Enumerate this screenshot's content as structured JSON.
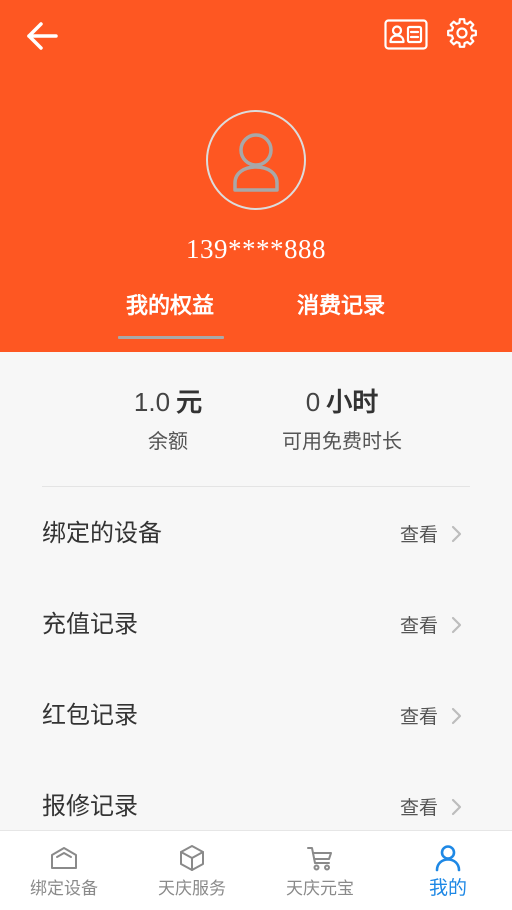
{
  "header": {
    "back_icon": "back-arrow-icon",
    "id_card_icon": "id-card-icon",
    "settings_icon": "gear-icon",
    "avatar_icon": "avatar-placeholder-icon",
    "phone": "139****888",
    "tabs": [
      {
        "label": "我的权益",
        "active": true
      },
      {
        "label": "消费记录",
        "active": false
      }
    ]
  },
  "stats": [
    {
      "value": "1.0",
      "unit": "元",
      "label": "余额"
    },
    {
      "value": "0",
      "unit": "小时",
      "label": "可用免费时长"
    }
  ],
  "list": [
    {
      "label": "绑定的设备",
      "action": "查看",
      "icon": "chevron-right-icon"
    },
    {
      "label": "充值记录",
      "action": "查看",
      "icon": "chevron-right-icon"
    },
    {
      "label": "红包记录",
      "action": "查看",
      "icon": "chevron-right-icon"
    },
    {
      "label": "报修记录",
      "action": "查看",
      "icon": "chevron-right-icon"
    }
  ],
  "nav": [
    {
      "label": "绑定设备",
      "icon": "house-icon",
      "active": false
    },
    {
      "label": "天庆服务",
      "icon": "cube-icon",
      "active": false
    },
    {
      "label": "天庆元宝",
      "icon": "cart-icon",
      "active": false
    },
    {
      "label": "我的",
      "icon": "person-icon",
      "active": true
    }
  ],
  "colors": {
    "header_bg": "#FE5722",
    "content_bg": "#F7F7F7",
    "nav_active": "#1E88E5",
    "nav_inactive": "#8A8A8A"
  }
}
